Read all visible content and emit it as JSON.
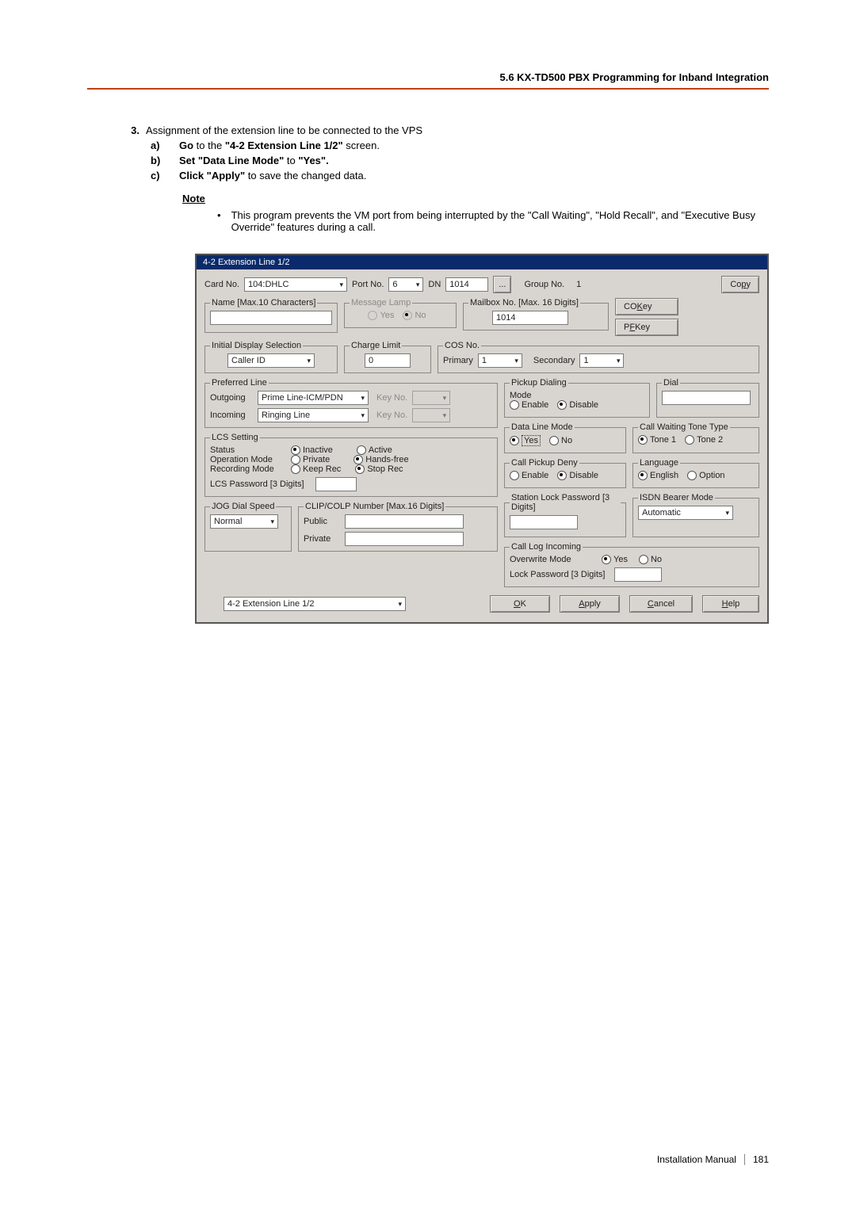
{
  "header": "5.6 KX-TD500 PBX Programming for Inband Integration",
  "step_num": "3.",
  "step_text": "Assignment of the extension line to be connected to the VPS",
  "sub": {
    "a": {
      "letter": "a)",
      "b1": "Go",
      "t1": " to the ",
      "b2": "\"4-2 Extension Line 1/2\"",
      "t2": " screen."
    },
    "b": {
      "letter": "b)",
      "b1": "Set ",
      "b2": "\"Data Line Mode\"",
      "t1": " to ",
      "b3": "\"Yes\"."
    },
    "c": {
      "letter": "c)",
      "b1": "Click \"Apply\"",
      "t1": " to save the changed data."
    }
  },
  "note_label": "Note",
  "note_bullet": "•",
  "note_text": "This program prevents the VM port from being interrupted by the \"Call Waiting\", \"Hold Recall\", and \"Executive Busy Override\" features during a call.",
  "fig": {
    "title": "4-2 Extension Line 1/2",
    "top": {
      "cardno_lbl": "Card No.",
      "cardno_val": "104:DHLC",
      "portno_lbl": "Port No.",
      "portno_val": "6",
      "dn_lbl": "DN",
      "dn_val": "1014",
      "ellipsis": "...",
      "group_lbl": "Group No.",
      "group_val": "1",
      "copy_btn": "Copy"
    },
    "name_legend": "Name [Max.10 Characters]",
    "msg_legend": "Message Lamp",
    "msg_yes": "Yes",
    "msg_no": "No",
    "mailbox_legend": "Mailbox No. [Max. 16 Digits]",
    "mailbox_val": "1014",
    "cokey": "CO Key",
    "pfkey": "PF Key",
    "ids_legend": "Initial Display Selection",
    "ids_val": "Caller ID",
    "charge_legend": "Charge Limit",
    "charge_val": "0",
    "cos_legend": "COS No.",
    "cos_primary": "Primary",
    "cos_primary_val": "1",
    "cos_secondary": "Secondary",
    "cos_secondary_val": "1",
    "pref_legend": "Preferred Line",
    "out_lbl": "Outgoing",
    "out_val": "Prime Line-ICM/PDN",
    "keyno_lbl": "Key No.",
    "in_lbl": "Incoming",
    "in_val": "Ringing Line",
    "lcs_legend": "LCS Setting",
    "lcs_status": "Status",
    "lcs_inactive": "Inactive",
    "lcs_active": "Active",
    "lcs_opmode": "Operation Mode",
    "lcs_private": "Private",
    "lcs_handsfree": "Hands-free",
    "lcs_recmode": "Recording Mode",
    "lcs_keep": "Keep Rec",
    "lcs_stop": "Stop Rec",
    "lcs_pass": "LCS Password [3 Digits]",
    "jog_legend": "JOG Dial Speed",
    "jog_val": "Normal",
    "clip_legend": "CLIP/COLP Number [Max.16 Digits]",
    "clip_public": "Public",
    "clip_private": "Private",
    "pickup_legend": "Pickup Dialing",
    "pickup_mode": "Mode",
    "pickup_enable": "Enable",
    "pickup_disable": "Disable",
    "dial_legend": "Dial",
    "dataline_legend": "Data Line Mode",
    "dlm_yes": "Yes",
    "dlm_no": "No",
    "cwt_legend": "Call Waiting Tone Type",
    "cwt_t1": "Tone 1",
    "cwt_t2": "Tone 2",
    "cpd_legend": "Call Pickup Deny",
    "cpd_enable": "Enable",
    "cpd_disable": "Disable",
    "lang_legend": "Language",
    "lang_en": "English",
    "lang_opt": "Option",
    "slp_legend": "Station Lock Password [3 Digits]",
    "isdn_legend": "ISDN Bearer Mode",
    "isdn_val": "Automatic",
    "cli_legend": "Call Log Incoming",
    "cli_ov": "Overwrite Mode",
    "cli_yes": "Yes",
    "cli_no": "No",
    "cli_lock": "Lock Password [3 Digits]",
    "bottom_sel": "4-2 Extension Line 1/2",
    "ok": "OK",
    "apply": "Apply",
    "cancel": "Cancel",
    "help": "Help"
  },
  "footer": {
    "text": "Installation Manual",
    "page": "181"
  }
}
